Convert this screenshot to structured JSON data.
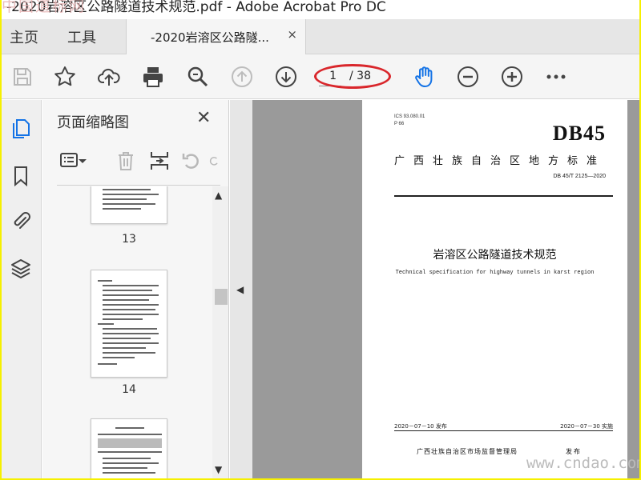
{
  "window": {
    "title": "-2020岩溶区公路隧道技术规范.pdf - Adobe Acrobat Pro DC",
    "watermark": "中国道标网"
  },
  "tabs": {
    "home": "主页",
    "tools": "工具",
    "document": "-2020岩溶区公路隧...",
    "close": "×"
  },
  "toolbar": {
    "current_page": "1",
    "total_pages": "/ 38",
    "accent_color": "#1473e6",
    "highlight_color": "#d9262b"
  },
  "panel": {
    "title": "页面缩略图",
    "close": "✕",
    "thumbnails": [
      {
        "label": "13"
      },
      {
        "label": "14"
      }
    ]
  },
  "page": {
    "ics": "ICS  93.080.01",
    "p": "P 66",
    "db": "DB45",
    "standard": "广西壮族自治区地方标准",
    "code": "DB 45/T 2125—2020",
    "title_cn": "岩溶区公路隧道技术规范",
    "title_en": "Technical specification for highway tunnels in karst region",
    "issue_date": "2020－07－10 发布",
    "impl_date": "2020－07－30 实施",
    "publisher": "广西壮族自治区市场监督管理局",
    "publish": "发布"
  },
  "footer": {
    "site": "www.cndao.com"
  }
}
